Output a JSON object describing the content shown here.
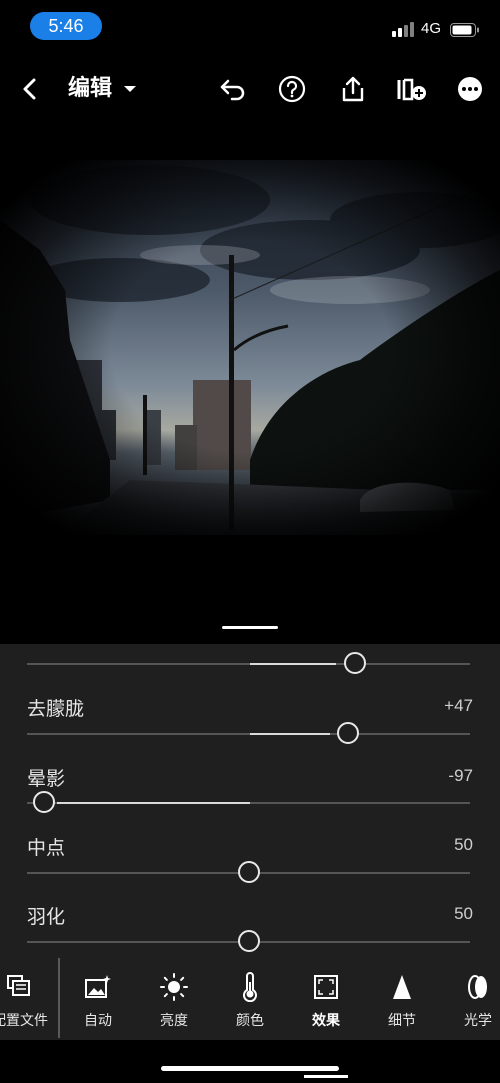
{
  "status": {
    "time": "5:46",
    "network": "4G",
    "time_pill_color": "#1a7fe6"
  },
  "toolbar": {
    "title": "编辑",
    "icons": [
      "back-chevron-icon",
      "title-dropdown-icon",
      "undo-icon",
      "help-icon",
      "share-icon",
      "add-preset-icon",
      "more-icon"
    ]
  },
  "adjustments": {
    "top_partial": {
      "value_fraction": 0.74
    },
    "dehaze": {
      "label": "去朦胧",
      "value": "+47",
      "position_fraction": 0.72
    },
    "vignette": {
      "label": "晕影",
      "value": "-97",
      "position_fraction": 0.04
    },
    "midpoint": {
      "label": "中点",
      "value": "50",
      "position_fraction": 0.5
    },
    "feather": {
      "label": "羽化",
      "value": "50",
      "position_fraction": 0.5
    }
  },
  "tabs": [
    {
      "label": "配置文件",
      "icon": "profiles-icon"
    },
    {
      "label": "自动",
      "icon": "auto-magic-icon"
    },
    {
      "label": "亮度",
      "icon": "sun-brightness-icon"
    },
    {
      "label": "颜色",
      "icon": "thermometer-icon"
    },
    {
      "label": "效果",
      "icon": "effects-square-icon",
      "active": true
    },
    {
      "label": "细节",
      "icon": "detail-triangle-icon"
    },
    {
      "label": "光学",
      "icon": "optics-lens-icon"
    }
  ]
}
